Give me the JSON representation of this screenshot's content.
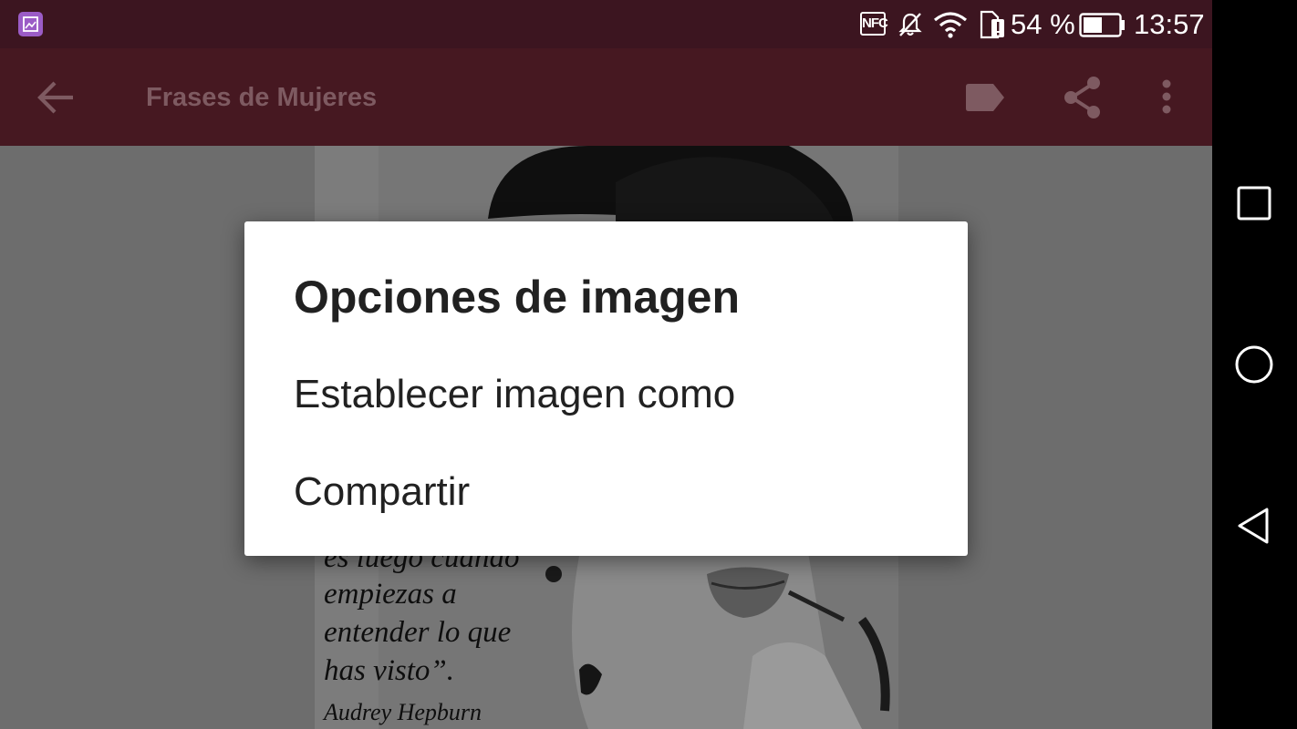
{
  "status_bar": {
    "nfc_label": "NFC",
    "battery_percent": "54 %",
    "battery_level": 0.54,
    "time": "13:57",
    "icons": [
      "gallery-notification-icon",
      "nfc-icon",
      "mute-icon",
      "wifi-icon",
      "sim-alert-icon",
      "battery-icon"
    ]
  },
  "app_bar": {
    "title": "Frases de Mujeres",
    "icons": [
      "back-arrow-icon",
      "tag-icon",
      "share-icon",
      "more-vert-icon"
    ]
  },
  "content": {
    "quote_lines": [
      "es luego cuando",
      "empiezas a",
      "entender lo que",
      "has visto”."
    ],
    "quote_author": "Audrey Hepburn"
  },
  "dialog": {
    "title": "Opciones de imagen",
    "options": [
      "Establecer imagen como",
      "Compartir"
    ]
  },
  "nav_bar": {
    "icons": [
      "recent-apps-icon",
      "home-icon",
      "back-icon"
    ]
  },
  "colors": {
    "status_bar": "#3c1520",
    "app_bar": "#461821",
    "app_title": "#7e5a61",
    "dialog_bg": "#ffffff",
    "dialog_text": "#212121",
    "scrim_content": "#6d6d6d"
  }
}
